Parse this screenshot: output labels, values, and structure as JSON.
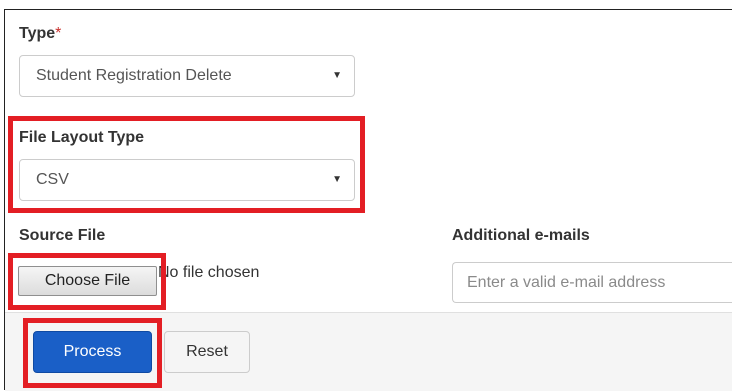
{
  "form": {
    "type": {
      "label": "Type",
      "required_mark": "*",
      "selected": "Student Registration Delete"
    },
    "file_layout": {
      "label": "File Layout Type",
      "selected": "CSV"
    },
    "source_file": {
      "label": "Source File",
      "button_label": "Choose File",
      "status": "No file chosen"
    },
    "additional_emails": {
      "label": "Additional e-mails",
      "placeholder": "Enter a valid e-mail address"
    }
  },
  "actions": {
    "process_label": "Process",
    "reset_label": "Reset"
  },
  "colors": {
    "highlight": "#e31e24",
    "primary_button": "#1a5fc7",
    "footer_bg": "#f5f5f5"
  }
}
